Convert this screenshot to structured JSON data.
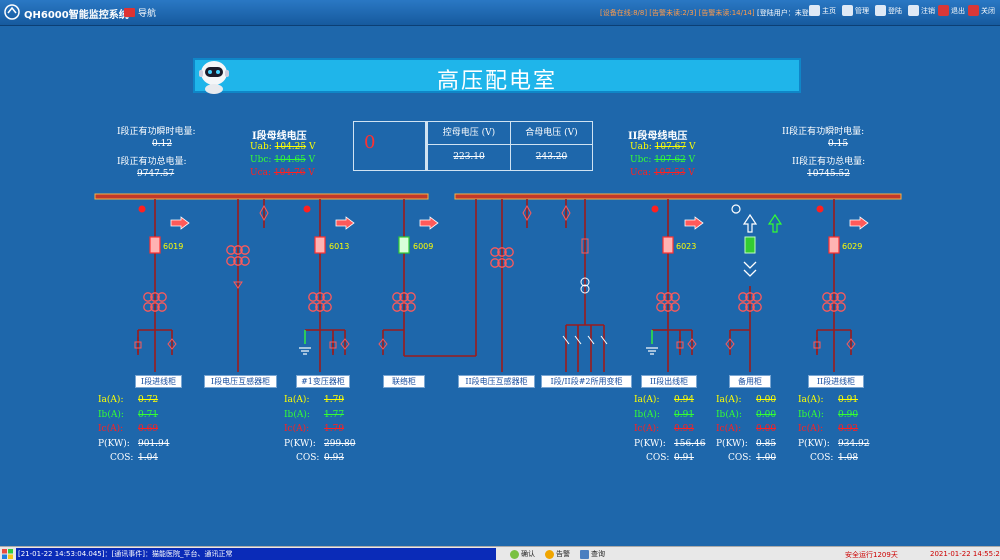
{
  "header": {
    "system_title": "QH6000智能监控系统",
    "nav_label": "导航",
    "status_text": "[设备在线:8/8] [告警未读:2/3] [告警未读:14/14]",
    "user_label": "[登陆用户：",
    "user_value": "未登陆]",
    "buttons": [
      "主页",
      "管理",
      "登陆",
      "注销",
      "退出",
      "关闭"
    ]
  },
  "title": "高压配电室",
  "left_energy": {
    "active_power_label": "I段正有功瞬时电量:",
    "active_power_value": "0.12",
    "total_energy_label": "I段正有功总电量:",
    "total_energy_value": "9747.57"
  },
  "right_energy": {
    "active_power_label": "II段正有功瞬时电量:",
    "active_power_value": "0.15",
    "total_energy_label": "II段正有功总电量:",
    "total_energy_value": "10745.52"
  },
  "bus1": {
    "title": "I段母线电压",
    "uab_label": "Uab:",
    "uab_value": "104.25",
    "uab_unit": "V",
    "ubc_label": "Ubc:",
    "ubc_value": "104.65",
    "ubc_unit": "V",
    "uca_label": "Uca:",
    "uca_value": "104.76",
    "uca_unit": "V"
  },
  "bus2": {
    "title": "II段母线电压",
    "uab_label": "Uab:",
    "uab_value": "107.67",
    "uab_unit": "V",
    "ubc_label": "Ubc:",
    "ubc_value": "107.62",
    "ubc_unit": "V",
    "uca_label": "Uca:",
    "uca_value": "107.53",
    "uca_unit": "V"
  },
  "voltage_table": {
    "status_symbol": "0",
    "col1_header": "控母电压 (V)",
    "col2_header": "合母电压 (V)",
    "col1_value": "223.10",
    "col2_value": "243.20"
  },
  "cabinets": [
    {
      "label": "I段进线柜",
      "id": "6019",
      "has_meter": true,
      "ia": "0.72",
      "ib": "0.71",
      "ic": "0.69",
      "p": "901.94",
      "cos": "1.04"
    },
    {
      "label": "I段电压互感器柜",
      "id": "",
      "has_meter": false
    },
    {
      "label": "#1变压器柜",
      "id": "6013",
      "has_meter": true,
      "ia": "1.79",
      "ib": "1.77",
      "ic": "1.79",
      "p": "299.80",
      "cos": "0.93"
    },
    {
      "label": "联络柜",
      "id": "6009",
      "has_meter": false
    },
    {
      "label": "II段电压互感器柜",
      "id": "",
      "has_meter": false
    },
    {
      "label": "I段/II段#2所用变柜",
      "id": "",
      "has_meter": false
    },
    {
      "label": "II段出线柜",
      "id": "6023",
      "has_meter": true,
      "ia": "0.94",
      "ib": "0.91",
      "ic": "0.93",
      "p": "156.46",
      "cos": "0.91"
    },
    {
      "label": "备用柜",
      "id": "",
      "has_meter": true,
      "ia": "0.00",
      "ib": "0.00",
      "ic": "0.00",
      "p": "0.85",
      "cos": "1.00"
    },
    {
      "label": "II段进线柜",
      "id": "6029",
      "has_meter": true,
      "ia": "0.91",
      "ib": "0.90",
      "ic": "0.92",
      "p": "934.92",
      "cos": "1.08"
    }
  ],
  "meter_labels": {
    "ia": "Ia(A):",
    "ib": "Ib(A):",
    "ic": "Ic(A):",
    "p": "P(KW):",
    "cos": "COS:"
  },
  "statusbar": {
    "message": "[21-01-22 14:53:04.045]：[通讯事件]：猫能医院_平台、通讯正常",
    "confirm": "确认",
    "alarm": "告警",
    "query": "查询",
    "runtime": "安全运行1209天",
    "datetime": "2021-01-22 14:55:28"
  },
  "colors": {
    "background": "#1e67ab",
    "busbar": "#c0392b",
    "title_box": "#1fb5ea",
    "breaker_closed": "#e05050",
    "breaker_open": "#33cc33"
  }
}
